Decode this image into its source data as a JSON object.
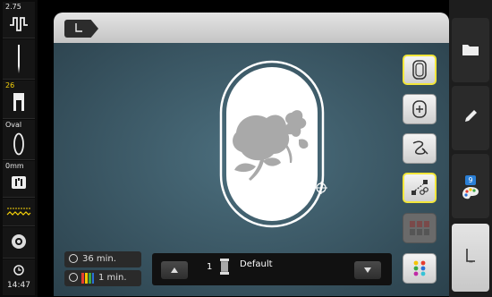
{
  "left_sidebar": {
    "stitch_width": "2.75",
    "row_count": "26",
    "hoop_label": "Oval",
    "offset_label": "0mm",
    "time_label": "14:47"
  },
  "colors": {
    "accent": "#f2e63a",
    "canvas": "#3f5d6a",
    "hoop": "#ffffff",
    "motif": "#a8a8a8"
  },
  "right_sidebar": {
    "color_badge": "9"
  },
  "bottom": {
    "total_time": "36 min.",
    "color_time": "1 min.",
    "color_number": "1",
    "color_name": "Default"
  }
}
